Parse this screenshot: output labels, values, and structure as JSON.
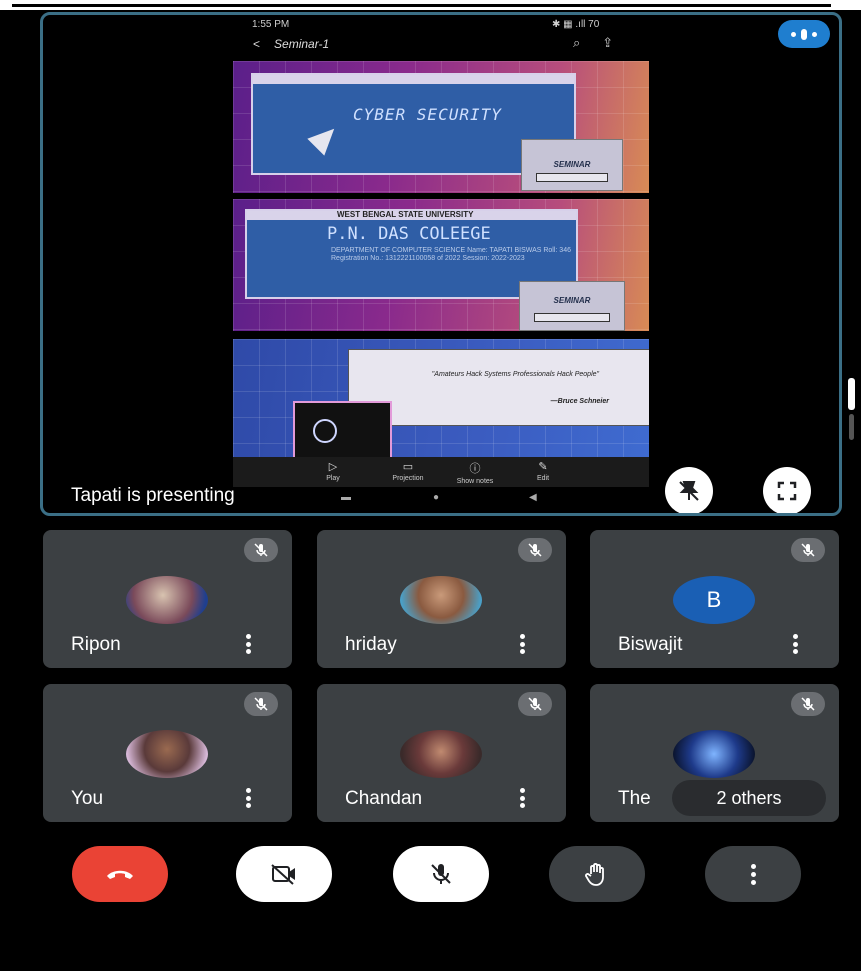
{
  "status_bar": {
    "time": "1:55 PM",
    "right": "✱ ▦ .ıll 70"
  },
  "document": {
    "title": "Seminar-1",
    "back": "<"
  },
  "slides": {
    "s1_title": "CYBER SECURITY",
    "s1_label": "SEMINAR",
    "s2_university": "WEST BENGAL STATE UNIVERSITY",
    "s2_college": "P.N. DAS COLEEGE",
    "s2_details": "DEPARTMENT OF COMPUTER SCIENCE Name: TAPATI BISWAS Roll: 346 Registration No.: 1312221100058 of 2022 Session: 2022-2023",
    "s2_label": "SEMINAR",
    "s3_quote": "\"Amateurs Hack Systems Professionals Hack People\"",
    "s3_author": "—Bruce Schneier"
  },
  "toolbar": {
    "play": "Play",
    "projection": "Projection",
    "notes": "Show notes",
    "edit": "Edit"
  },
  "presenting_text": "Tapati is presenting",
  "participants": [
    {
      "name": "Ripon",
      "avatar": "photo"
    },
    {
      "name": "hriday",
      "avatar": "photo"
    },
    {
      "name": "Biswajit",
      "avatar": "B"
    },
    {
      "name": "You",
      "avatar": "photo"
    },
    {
      "name": "Chandan",
      "avatar": "photo"
    },
    {
      "name": "The",
      "avatar": "photo"
    }
  ],
  "others_label": "2 others",
  "colors": {
    "end_call": "#ea4335",
    "tile": "#3c4043",
    "accent": "#1a5fb4"
  }
}
